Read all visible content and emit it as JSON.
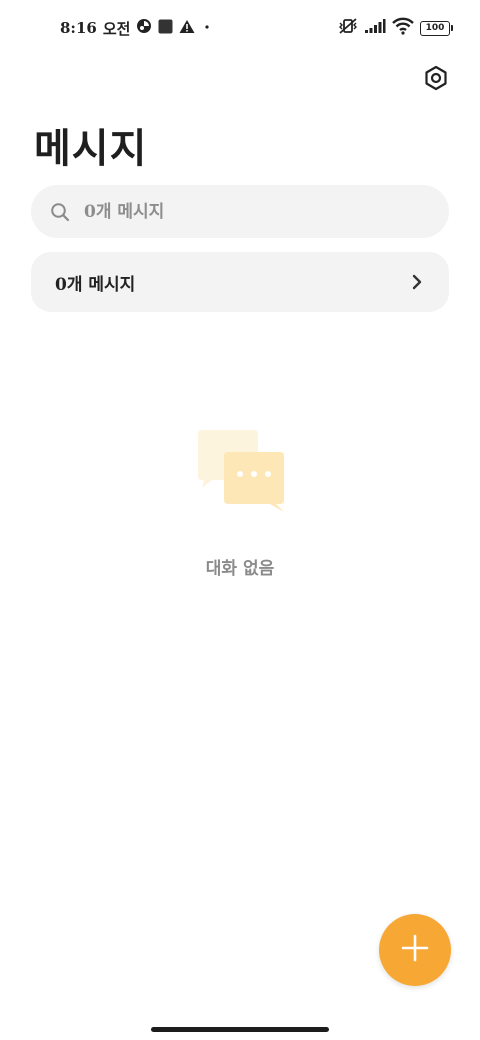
{
  "status_bar": {
    "time": "8:16",
    "ampm": "오전",
    "battery": "100",
    "icons": [
      "notification-app-icon",
      "square-app-icon",
      "warning-icon",
      "dot-icon",
      "vibrate-off-icon",
      "signal-icon",
      "wifi-icon",
      "battery-icon"
    ]
  },
  "header": {
    "title": "메시지",
    "settings_icon": "settings-hexagon-icon"
  },
  "search": {
    "placeholder": "0개 메시지",
    "value": "",
    "icon": "search-icon"
  },
  "count_row": {
    "label": "0개 메시지",
    "icon": "chevron-right-icon"
  },
  "empty_state": {
    "illustration": "chat-bubbles-icon",
    "text": "대화 없음"
  },
  "fab": {
    "icon": "plus-icon"
  },
  "colors": {
    "accent": "#f7a734",
    "surface": "#f3f3f3",
    "bubble_light": "#fdf4de",
    "bubble_dark": "#fde7b6"
  }
}
